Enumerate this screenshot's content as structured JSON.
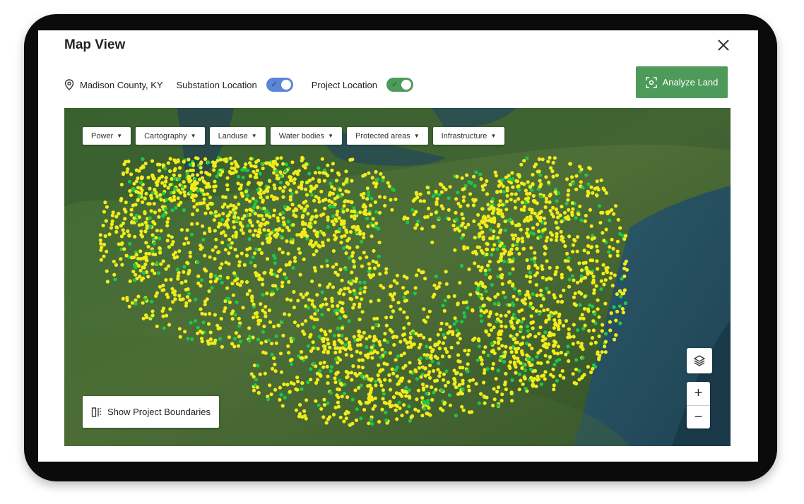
{
  "window": {
    "title": "Map View"
  },
  "toolbar": {
    "location": "Madison County, KY",
    "substation_label": "Substation Location",
    "substation_on": true,
    "substation_color": "#5b85d6",
    "project_label": "Project Location",
    "project_on": true,
    "project_color": "#4e9a5a",
    "analyze_label": "Analyze Land"
  },
  "filters": [
    {
      "label": "Power"
    },
    {
      "label": "Cartography"
    },
    {
      "label": "Landuse"
    },
    {
      "label": "Water bodies"
    },
    {
      "label": "Protected areas"
    },
    {
      "label": "Infrastructure"
    }
  ],
  "map": {
    "boundaries_label": "Show Project Boundaries",
    "zoom_in": "+",
    "zoom_out": "−",
    "marker_colors": {
      "substation": "#f2ec1a",
      "project": "#1ec74a"
    }
  },
  "icons": [
    "location-pin-icon",
    "close-icon",
    "scan-icon",
    "layers-icon",
    "split-panel-icon"
  ]
}
